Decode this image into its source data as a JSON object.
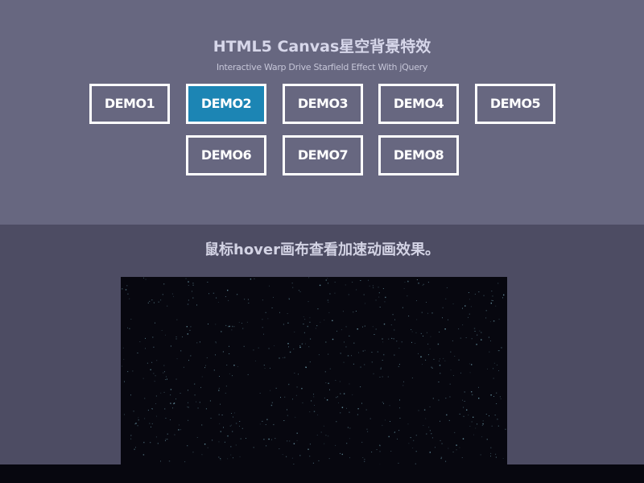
{
  "header": {
    "title": "HTML5 Canvas星空背景特效",
    "subtitle": "Interactive Warp Drive Starfield Effect With jQuery"
  },
  "demos": [
    {
      "label": "DEMO1",
      "active": false
    },
    {
      "label": "DEMO2",
      "active": true
    },
    {
      "label": "DEMO3",
      "active": false
    },
    {
      "label": "DEMO4",
      "active": false
    },
    {
      "label": "DEMO5",
      "active": false
    },
    {
      "label": "DEMO6",
      "active": false
    },
    {
      "label": "DEMO7",
      "active": false
    },
    {
      "label": "DEMO8",
      "active": false
    }
  ],
  "main": {
    "hint": "鼠标hover画布查看加速动画效果。"
  },
  "colors": {
    "header_bg": "#676780",
    "section_bg": "#4d4c63",
    "canvas_bg": "#07070f",
    "active_button": "#1c85b4",
    "star": "#7fb4c4"
  }
}
